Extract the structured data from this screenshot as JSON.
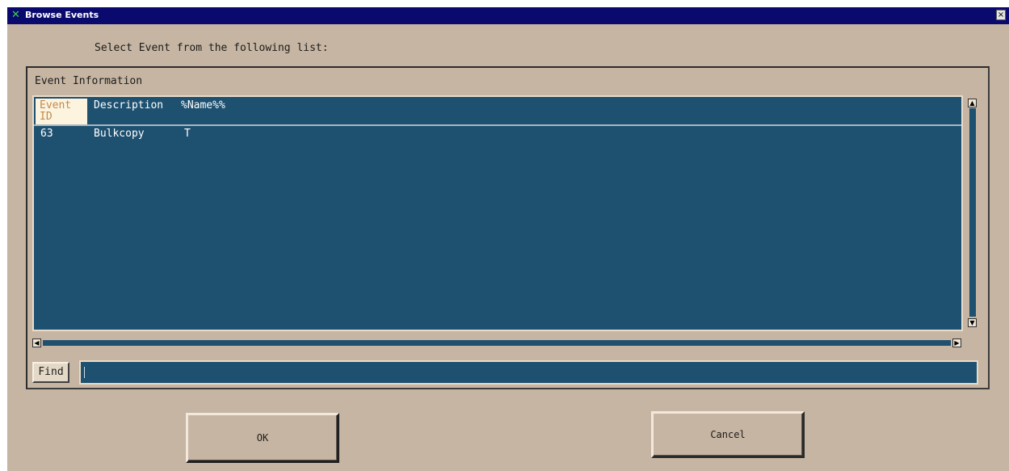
{
  "window": {
    "title": "Browse Events",
    "close_glyph": "×",
    "app_icon": "x-logo-icon"
  },
  "prompt": "Select Event from the following list:",
  "event_group": {
    "label": "Event Information",
    "columns": [
      "Event ID",
      "Description",
      "%Name%%"
    ],
    "rows": [
      {
        "event_id": "63",
        "description": "Bulkcopy",
        "name": "T"
      }
    ]
  },
  "find": {
    "button_label": "Find",
    "value": ""
  },
  "buttons": {
    "ok_label": "OK",
    "cancel_label": "Cancel"
  },
  "colors": {
    "dialog_bg": "#c6b5a2",
    "list_bg": "#1e5070",
    "title_bg": "#0a0a6e"
  }
}
